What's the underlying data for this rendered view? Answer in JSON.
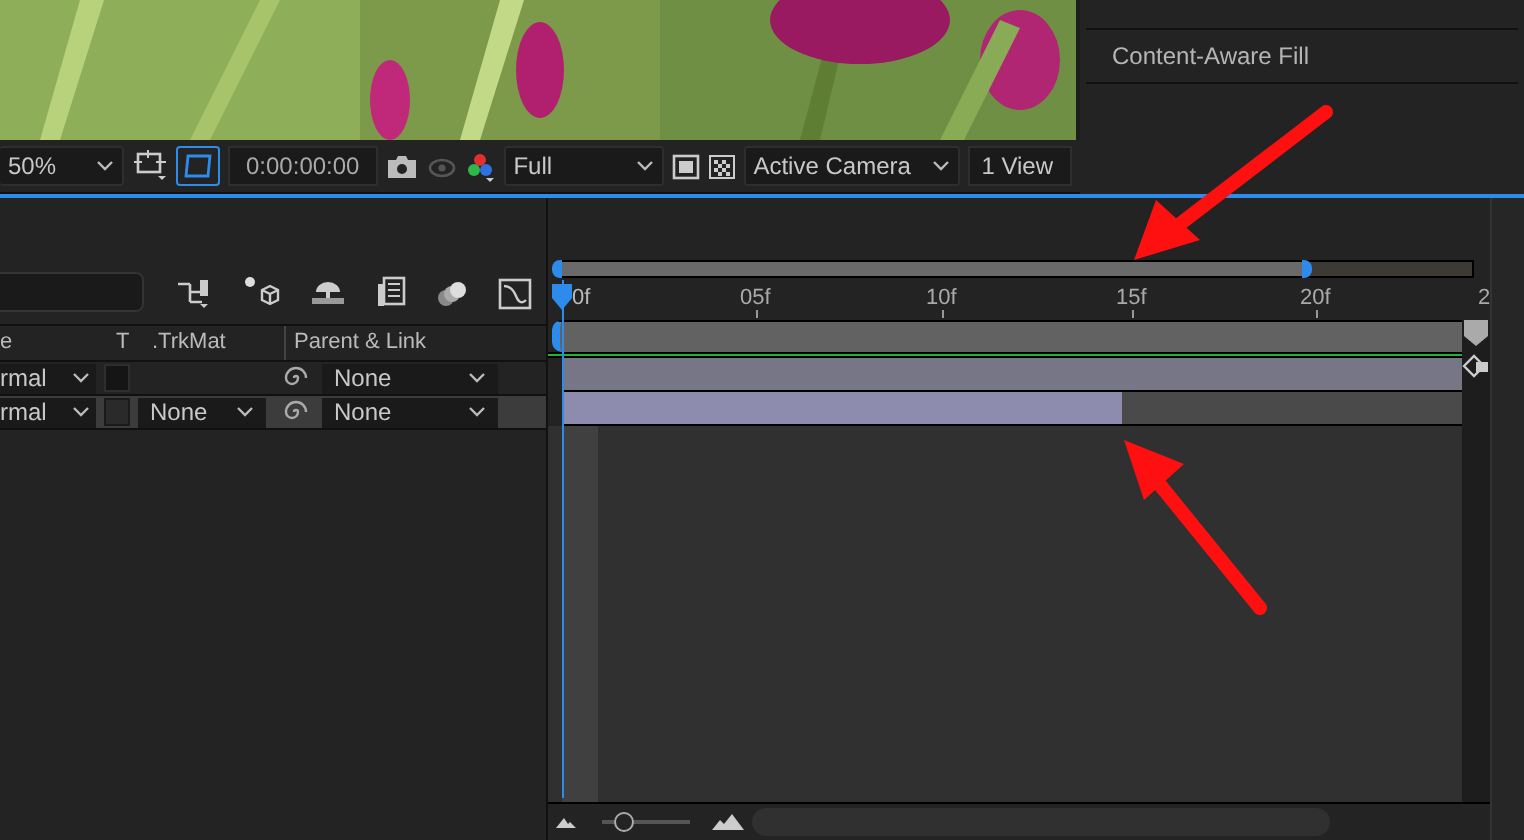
{
  "viewer_toolbar": {
    "zoom": "50%",
    "timecode": "0:00:00:00",
    "resolution": "Full",
    "camera": "Active Camera",
    "views": "1 View"
  },
  "side_panel": {
    "items": [
      "Content-Aware Fill"
    ]
  },
  "timeline": {
    "columns": [
      "e",
      "T",
      ".TrkMat",
      "Parent & Link"
    ],
    "layers": [
      {
        "mode": "rmal",
        "parent": "None"
      },
      {
        "mode": "rmal",
        "trkmat": "None",
        "parent": "None"
      }
    ],
    "ruler_labels": [
      "0f",
      "05f",
      "10f",
      "15f",
      "20f",
      "2"
    ],
    "zoom_slider": {
      "level": 0.25
    }
  }
}
